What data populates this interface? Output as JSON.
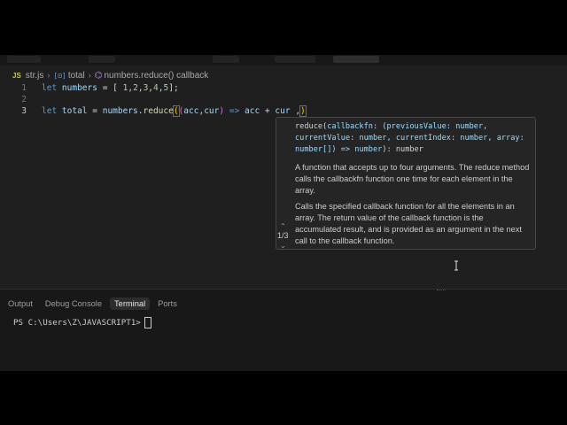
{
  "breadcrumb": {
    "file_icon": "JS",
    "file": "str.js",
    "variable_icon": "variable-icon",
    "variable": "total",
    "method_icon": "method-icon",
    "method": "numbers.reduce() callback"
  },
  "code": {
    "lines": [
      {
        "number": "1",
        "text": "let numbers = [ 1,2,3,4,5];"
      },
      {
        "number": "2",
        "text": ""
      },
      {
        "number": "3",
        "text": "let total = numbers.reduce((acc,cur) => acc + cur ,)"
      }
    ]
  },
  "hover": {
    "signature_name": "reduce(",
    "signature_param": "callbackfn:",
    "signature_rest_1": " (",
    "signature_p1": "previousValue",
    "signature_t1": ": number,",
    "signature_p2": "currentValue",
    "signature_t2": ": number, ",
    "signature_p3": "currentIndex",
    "signature_t3": ": number, ",
    "signature_p4": "array",
    "signature_t4": ":",
    "signature_line3_a": "number[]",
    "signature_line3_b": ") => ",
    "signature_line3_c": "number",
    "signature_line3_d": "): number",
    "description_1": "A function that accepts up to four arguments. The reduce method calls the callbackfn function one time for each element in the array.",
    "description_2": "Calls the specified callback function for all the elements in an array. The return value of the callback function is the accumulated result, and is provided as an argument in the next call to the callback function.",
    "overload_counter": "1/3",
    "overload_up_icon": "chevron-up-icon",
    "overload_down_icon": "chevron-down-icon"
  },
  "panel": {
    "tabs": [
      "Output",
      "Debug Console",
      "Terminal",
      "Ports"
    ],
    "active_tab": "Terminal",
    "prompt": "PS C:\\Users\\Z\\JAVASCRIPT1>"
  },
  "colors": {
    "editor_bg": "#1f1f1f",
    "panel_bg": "#181818",
    "keyword": "#569cd6",
    "variable": "#9cdcfe",
    "number": "#b5cea8",
    "function": "#dcdcaa",
    "type": "#4ec9b0"
  }
}
